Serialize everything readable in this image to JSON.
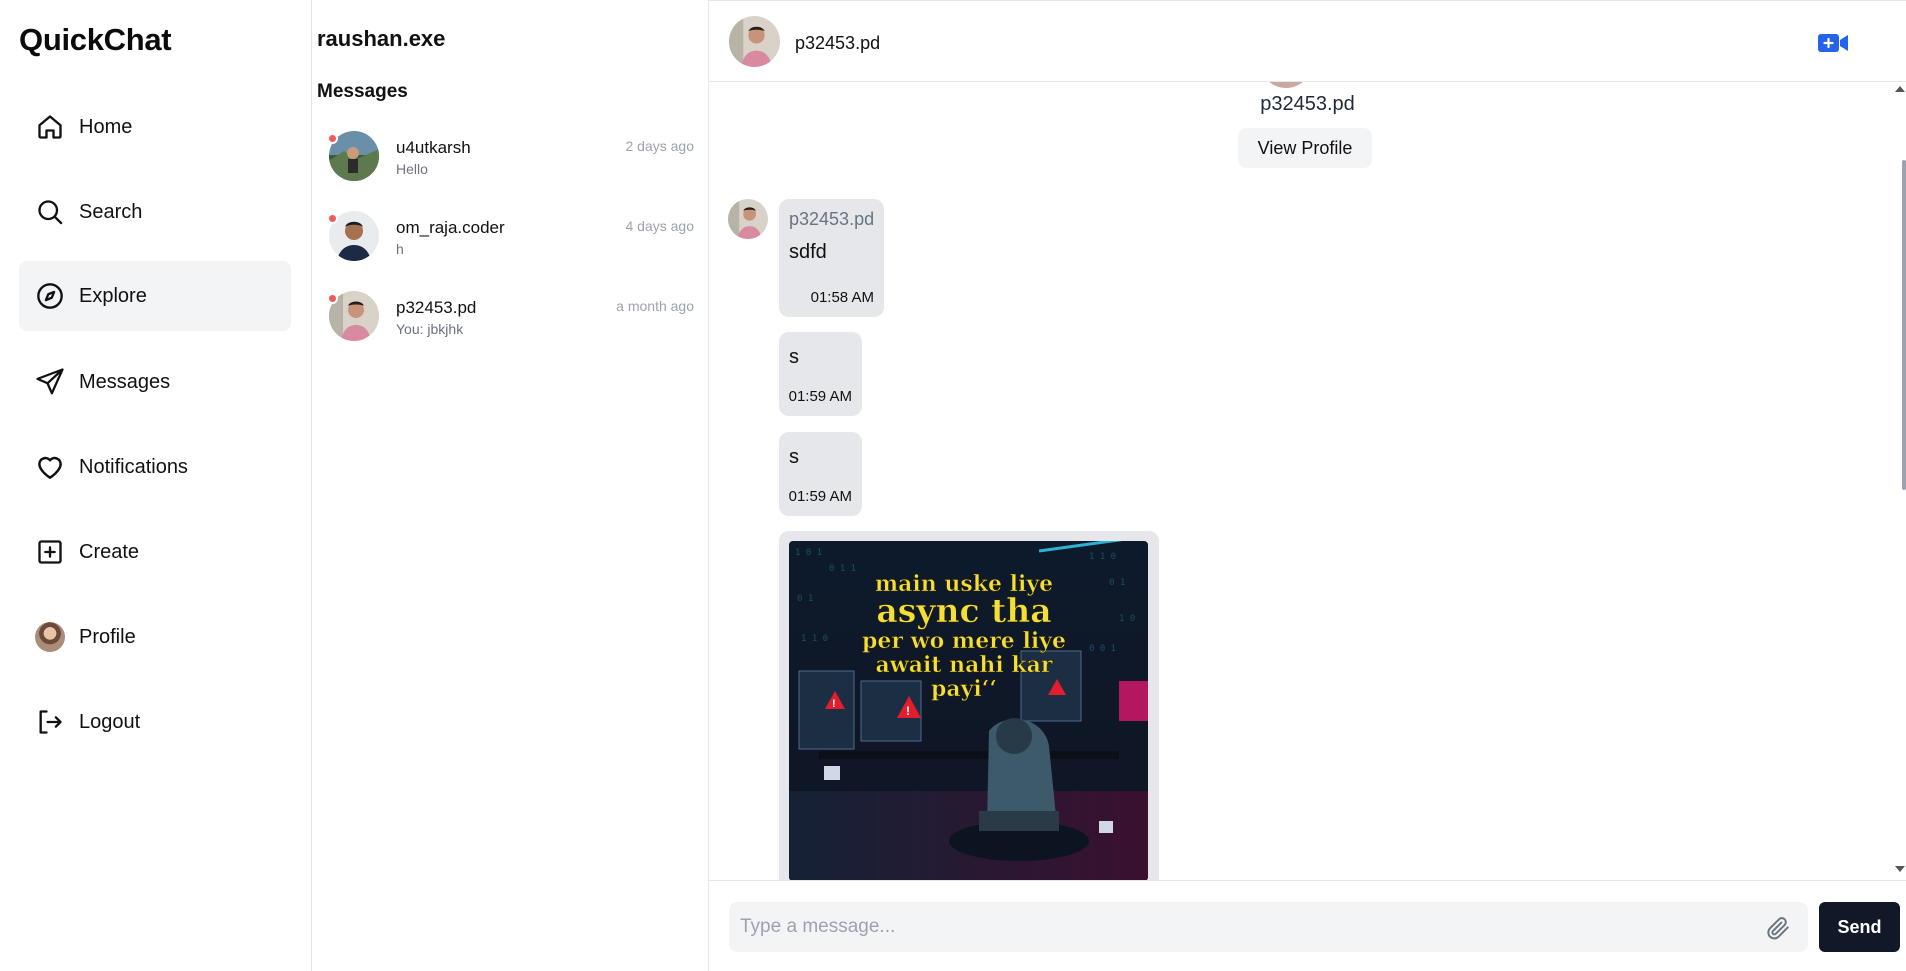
{
  "app": {
    "brand": "QuickChat",
    "accent_color": "#2563eb",
    "unread_dot_color": "#ef5a5a"
  },
  "nav": {
    "items": [
      {
        "label": "Home",
        "icon": "home-icon"
      },
      {
        "label": "Search",
        "icon": "search-icon"
      },
      {
        "label": "Explore",
        "icon": "compass-icon",
        "active": true
      },
      {
        "label": "Messages",
        "icon": "send-icon"
      },
      {
        "label": "Notifications",
        "icon": "heart-icon"
      },
      {
        "label": "Create",
        "icon": "plus-square-icon"
      },
      {
        "label": "Profile",
        "icon": "avatar"
      },
      {
        "label": "Logout",
        "icon": "logout-icon"
      }
    ]
  },
  "conversations": {
    "current_user": "raushan.exe",
    "heading": "Messages",
    "items": [
      {
        "name": "u4utkarsh",
        "last_message": "Hello",
        "time": "2 days ago",
        "unread": true
      },
      {
        "name": "om_raja.coder",
        "last_message": "h",
        "time": "4 days ago",
        "unread": true
      },
      {
        "name": "p32453.pd",
        "last_message": "You: jbkjhk",
        "time": "a month ago",
        "unread": true
      }
    ]
  },
  "chat": {
    "header_name": "p32453.pd",
    "profile_name": "p32453.pd",
    "view_profile_label": "View Profile",
    "messages": [
      {
        "sender": "p32453.pd",
        "text": "sdfd",
        "time": "01:58 AM"
      },
      {
        "text": "s",
        "time": "01:59 AM"
      },
      {
        "text": "s",
        "time": "01:59 AM"
      }
    ],
    "image_message": {
      "lines": [
        "main uske liye",
        "async tha",
        "per wo mere liye",
        "await nahi kar",
        "payi‘‘"
      ]
    },
    "composer": {
      "placeholder": "Type a message...",
      "value": "",
      "send_label": "Send"
    }
  }
}
